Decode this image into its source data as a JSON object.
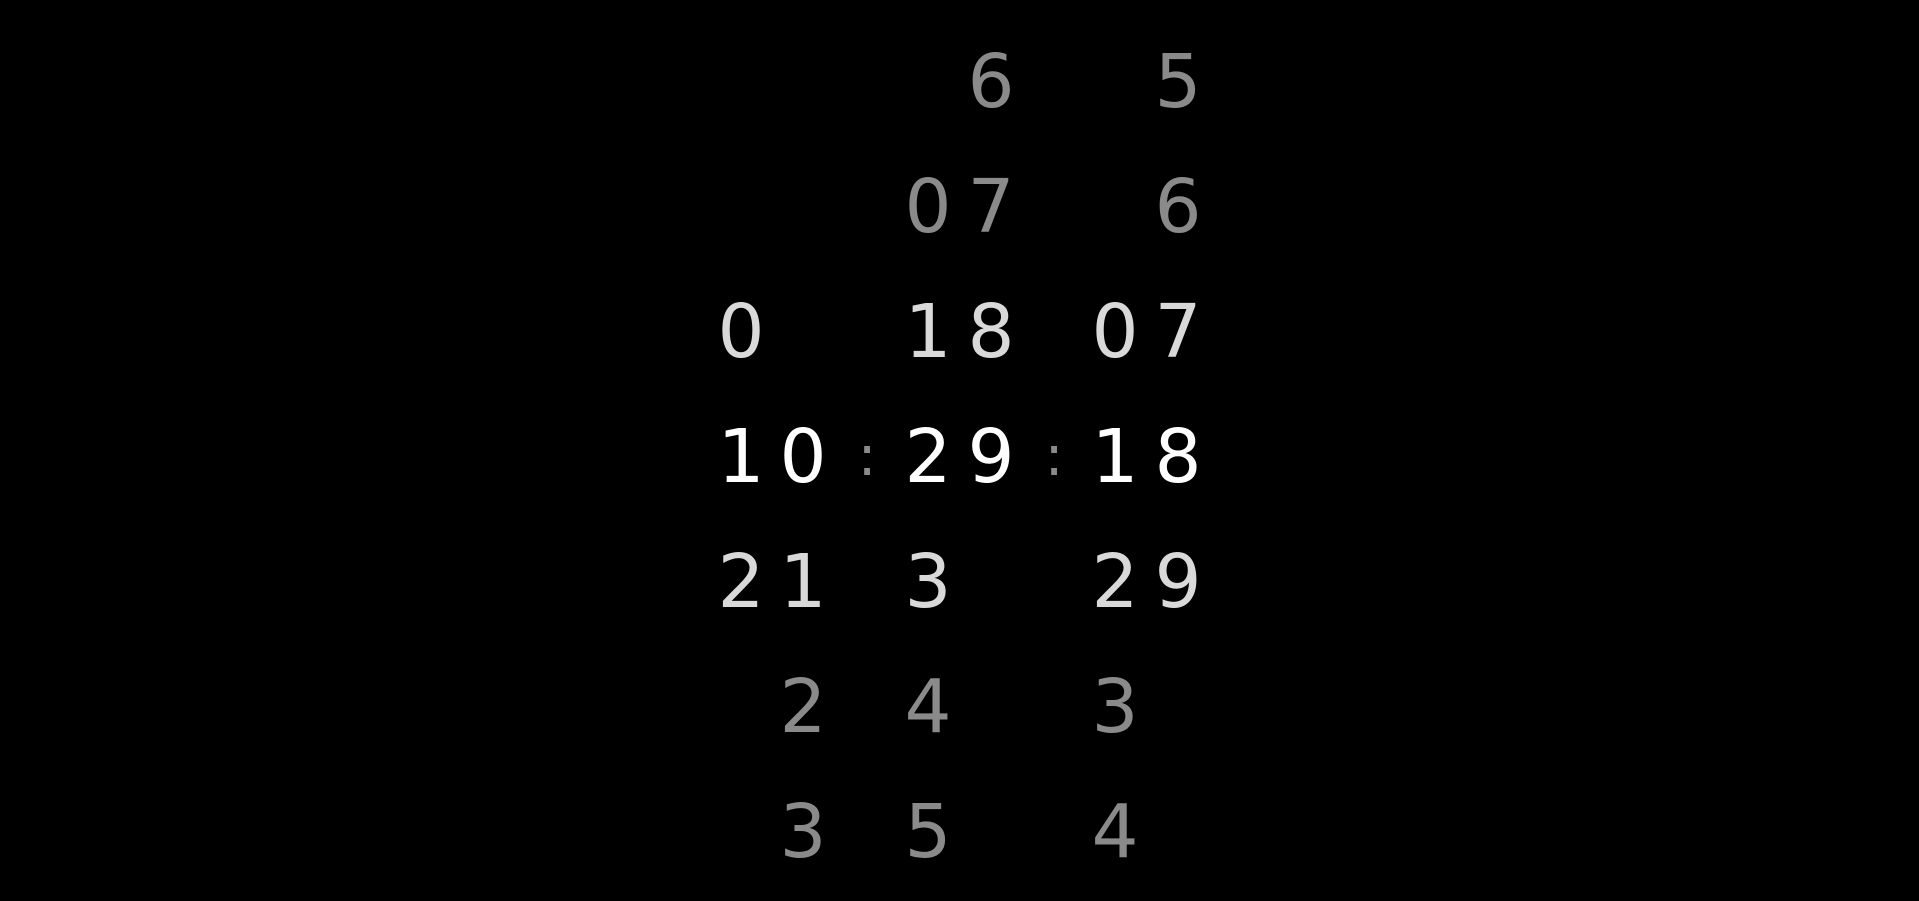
{
  "clock": {
    "time": "10:29:18",
    "columns": [
      {
        "name": "hour-tens",
        "rows": [
          "",
          "",
          "0",
          "1",
          "2",
          "",
          ""
        ]
      },
      {
        "name": "hour-ones",
        "rows": [
          "",
          "",
          "",
          "0",
          "1",
          "2",
          "3"
        ]
      },
      {
        "name": "minute-tens",
        "rows": [
          "",
          "0",
          "1",
          "2",
          "3",
          "4",
          "5"
        ]
      },
      {
        "name": "minute-ones",
        "rows": [
          "6",
          "7",
          "8",
          "9",
          "",
          "",
          ""
        ]
      },
      {
        "name": "second-tens",
        "rows": [
          "",
          "",
          "0",
          "1",
          "2",
          "3",
          "4"
        ]
      },
      {
        "name": "second-ones",
        "rows": [
          "5",
          "6",
          "7",
          "8",
          "9",
          "",
          ""
        ]
      }
    ],
    "separator": ":",
    "colors": {
      "background": "#000000",
      "current": "#ffffff",
      "adjacent": "#d9d9d9",
      "far": "#8a8a8a"
    }
  }
}
